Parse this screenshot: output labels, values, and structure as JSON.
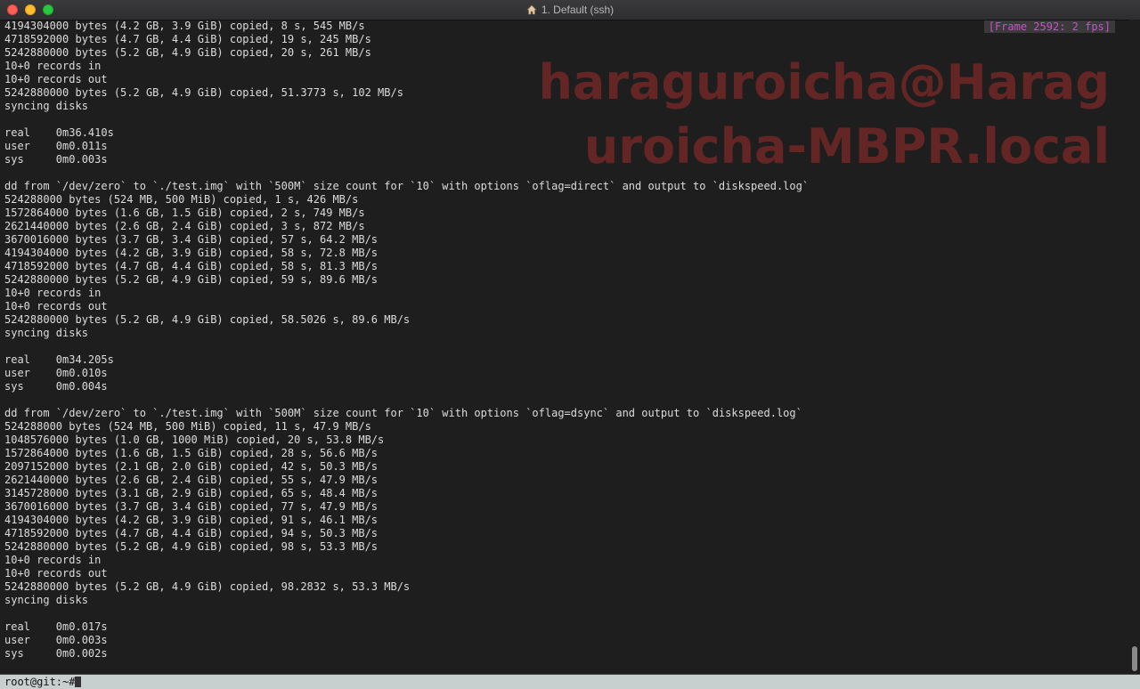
{
  "window": {
    "title": "1. Default (ssh)"
  },
  "overlay": {
    "frame_label": "[Frame 2592: 2 fps]",
    "watermark": "haraguroicha@Harag\nuroicha-MBPR.local"
  },
  "terminal": {
    "lines": [
      "4194304000 bytes (4.2 GB, 3.9 GiB) copied, 8 s, 545 MB/s",
      "4718592000 bytes (4.7 GB, 4.4 GiB) copied, 19 s, 245 MB/s",
      "5242880000 bytes (5.2 GB, 4.9 GiB) copied, 20 s, 261 MB/s",
      "10+0 records in",
      "10+0 records out",
      "5242880000 bytes (5.2 GB, 4.9 GiB) copied, 51.3773 s, 102 MB/s",
      "syncing disks",
      "",
      "real    0m36.410s",
      "user    0m0.011s",
      "sys     0m0.003s",
      "",
      "dd from `/dev/zero` to `./test.img` with `500M` size count for `10` with options `oflag=direct` and output to `diskspeed.log`",
      "524288000 bytes (524 MB, 500 MiB) copied, 1 s, 426 MB/s",
      "1572864000 bytes (1.6 GB, 1.5 GiB) copied, 2 s, 749 MB/s",
      "2621440000 bytes (2.6 GB, 2.4 GiB) copied, 3 s, 872 MB/s",
      "3670016000 bytes (3.7 GB, 3.4 GiB) copied, 57 s, 64.2 MB/s",
      "4194304000 bytes (4.2 GB, 3.9 GiB) copied, 58 s, 72.8 MB/s",
      "4718592000 bytes (4.7 GB, 4.4 GiB) copied, 58 s, 81.3 MB/s",
      "5242880000 bytes (5.2 GB, 4.9 GiB) copied, 59 s, 89.6 MB/s",
      "10+0 records in",
      "10+0 records out",
      "5242880000 bytes (5.2 GB, 4.9 GiB) copied, 58.5026 s, 89.6 MB/s",
      "syncing disks",
      "",
      "real    0m34.205s",
      "user    0m0.010s",
      "sys     0m0.004s",
      "",
      "dd from `/dev/zero` to `./test.img` with `500M` size count for `10` with options `oflag=dsync` and output to `diskspeed.log`",
      "524288000 bytes (524 MB, 500 MiB) copied, 11 s, 47.9 MB/s",
      "1048576000 bytes (1.0 GB, 1000 MiB) copied, 20 s, 53.8 MB/s",
      "1572864000 bytes (1.6 GB, 1.5 GiB) copied, 28 s, 56.6 MB/s",
      "2097152000 bytes (2.1 GB, 2.0 GiB) copied, 42 s, 50.3 MB/s",
      "2621440000 bytes (2.6 GB, 2.4 GiB) copied, 55 s, 47.9 MB/s",
      "3145728000 bytes (3.1 GB, 2.9 GiB) copied, 65 s, 48.4 MB/s",
      "3670016000 bytes (3.7 GB, 3.4 GiB) copied, 77 s, 47.9 MB/s",
      "4194304000 bytes (4.2 GB, 3.9 GiB) copied, 91 s, 46.1 MB/s",
      "4718592000 bytes (4.7 GB, 4.4 GiB) copied, 94 s, 50.3 MB/s",
      "5242880000 bytes (5.2 GB, 4.9 GiB) copied, 98 s, 53.3 MB/s",
      "10+0 records in",
      "10+0 records out",
      "5242880000 bytes (5.2 GB, 4.9 GiB) copied, 98.2832 s, 53.3 MB/s",
      "syncing disks",
      "",
      "real    0m0.017s",
      "user    0m0.003s",
      "sys     0m0.002s"
    ]
  },
  "statusbar": {
    "prompt": "root@git:~#"
  },
  "colors": {
    "background": "#1e1e1e",
    "text": "#dcdcdc",
    "frame_label": "#c653c6",
    "watermark": "#802828",
    "statusbar": "#c8cfcf"
  },
  "icons": {
    "title": "home-icon",
    "window_controls": [
      "close-icon",
      "minimize-icon",
      "zoom-icon"
    ]
  }
}
